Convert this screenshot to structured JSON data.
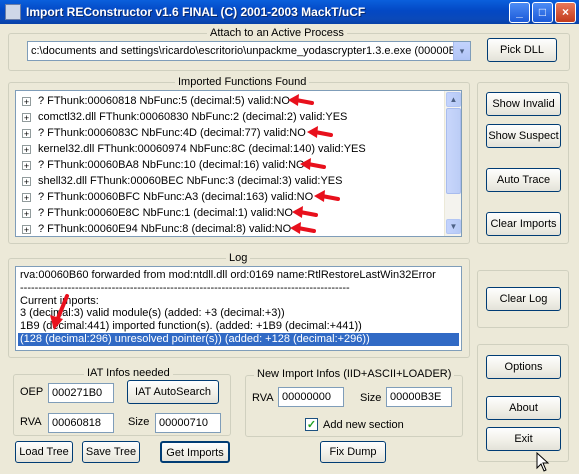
{
  "window": {
    "title": "Import REConstructor v1.6 FINAL (C) 2001-2003 MackT/uCF",
    "minimize": "_",
    "maximize": "□",
    "close": "×"
  },
  "attach": {
    "group_title": "Attach to an Active Process",
    "process_value": "c:\\documents and settings\\ricardo\\escritorio\\unpackme_yodascrypter1.3.e.exe (00000B90",
    "combo_arrow": "▾",
    "pick_dll": "Pick DLL"
  },
  "imports": {
    "group_title": "Imported Functions Found",
    "items": [
      {
        "text": "? FThunk:00060818 NbFunc:5 (decimal:5) valid:NO",
        "flagged": true
      },
      {
        "text": "comctl32.dll FThunk:00060830 NbFunc:2 (decimal:2) valid:YES",
        "flagged": false
      },
      {
        "text": "? FThunk:0006083C NbFunc:4D (decimal:77) valid:NO",
        "flagged": true
      },
      {
        "text": "kernel32.dll FThunk:00060974 NbFunc:8C (decimal:140) valid:YES",
        "flagged": false
      },
      {
        "text": "? FThunk:00060BA8 NbFunc:10 (decimal:16) valid:NO",
        "flagged": true
      },
      {
        "text": "shell32.dll FThunk:00060BEC NbFunc:3 (decimal:3) valid:YES",
        "flagged": false
      },
      {
        "text": "? FThunk:00060BFC NbFunc:A3 (decimal:163) valid:NO",
        "flagged": true
      },
      {
        "text": "? FThunk:00060E8C NbFunc:1 (decimal:1) valid:NO",
        "flagged": true
      },
      {
        "text": "? FThunk:00060E94 NbFunc:8 (decimal:8) valid:NO",
        "flagged": true
      }
    ],
    "expander": "+"
  },
  "right_buttons": {
    "show_invalid": "Show Invalid",
    "show_suspect": "Show Suspect",
    "auto_trace": "Auto Trace",
    "clear_imports": "Clear Imports",
    "clear_log": "Clear Log",
    "options": "Options",
    "about": "About",
    "exit": "Exit"
  },
  "log": {
    "group_title": "Log",
    "lines": [
      {
        "text": "rva:00060B60 forwarded from mod:ntdll.dll ord:0169 name:RtlRestoreLastWin32Error",
        "selected": false
      },
      {
        "text": "------------------------------------------------------------------------------------------",
        "selected": false
      },
      {
        "text": "Current imports:",
        "selected": false
      },
      {
        "text": "3 (decimal:3) valid module(s) (added: +3 (decimal:+3))",
        "selected": false
      },
      {
        "text": "1B9 (decimal:441) imported function(s). (added: +1B9 (decimal:+441))",
        "selected": false
      },
      {
        "text": "(128 (decimal:296) unresolved pointer(s)) (added: +128 (decimal:+296))",
        "selected": true
      }
    ]
  },
  "iat": {
    "group_title": "IAT Infos needed",
    "oep_label": "OEP",
    "oep_value": "000271B0",
    "autosearch": "IAT AutoSearch",
    "rva_label": "RVA",
    "rva_value": "00060818",
    "size_label": "Size",
    "size_value": "00000710"
  },
  "new_import": {
    "group_title": "New Import Infos (IID+ASCII+LOADER)",
    "rva_label": "RVA",
    "rva_value": "00000000",
    "size_label": "Size",
    "size_value": "00000B3E",
    "add_section_label": "Add new section",
    "add_section_checked": true
  },
  "bottom_buttons": {
    "load_tree": "Load Tree",
    "save_tree": "Save Tree",
    "get_imports": "Get Imports",
    "fix_dump": "Fix Dump"
  },
  "colors": {
    "annotation_arrow": "#e8101c",
    "selection": "#316ac5"
  }
}
